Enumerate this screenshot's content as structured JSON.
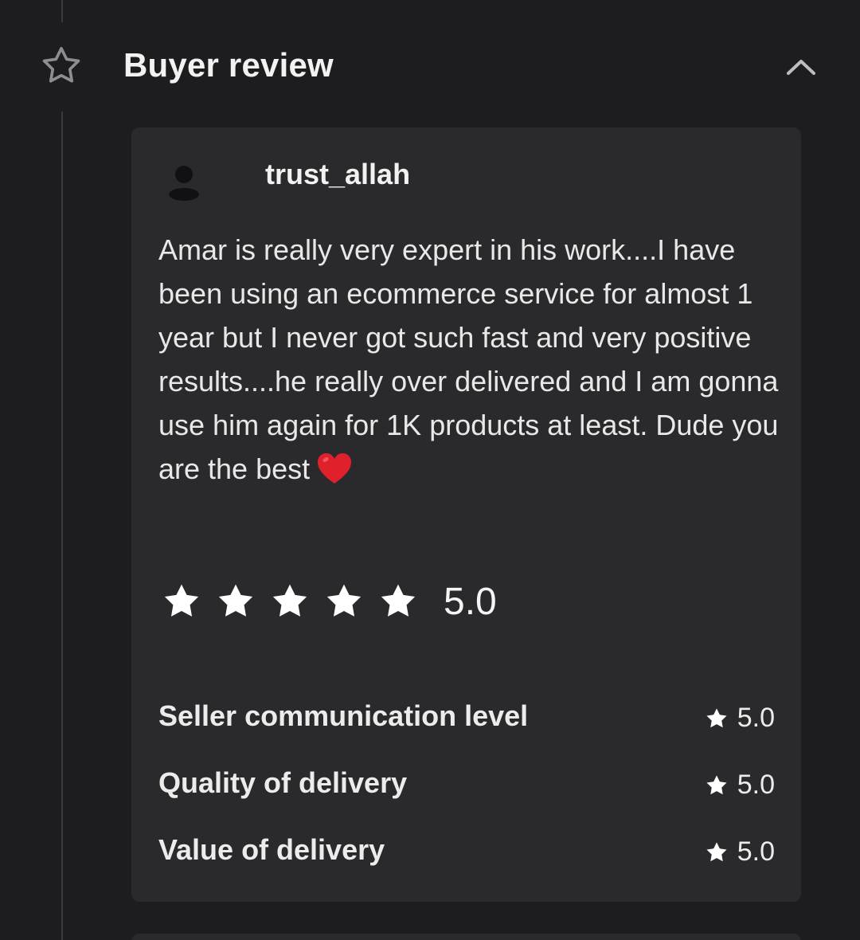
{
  "section": {
    "title": "Buyer review",
    "icon": "star-outline-icon",
    "toggle_icon": "chevron-up-icon"
  },
  "review": {
    "reviewer_name": "trust_allah",
    "avatar_icon": "user-avatar-icon",
    "text": "Amar is really very expert in his work....I have been using an ecommerce service for almost 1 year but I never got such fast and very positive results....he really over delivered and I am gonna use him again for 1K products at least.  Dude you are the best",
    "emoji": "red-heart-icon",
    "rating": {
      "stars": 5,
      "max_stars": 5,
      "value": "5.0"
    },
    "breakdown": [
      {
        "label": "Seller communication level",
        "value": "5.0"
      },
      {
        "label": "Quality of delivery",
        "value": "5.0"
      },
      {
        "label": "Value of delivery",
        "value": "5.0"
      }
    ]
  },
  "colors": {
    "background": "#1d1d1f",
    "card": "#2a2a2d",
    "text": "#ededed",
    "heart": "#e0202b"
  }
}
